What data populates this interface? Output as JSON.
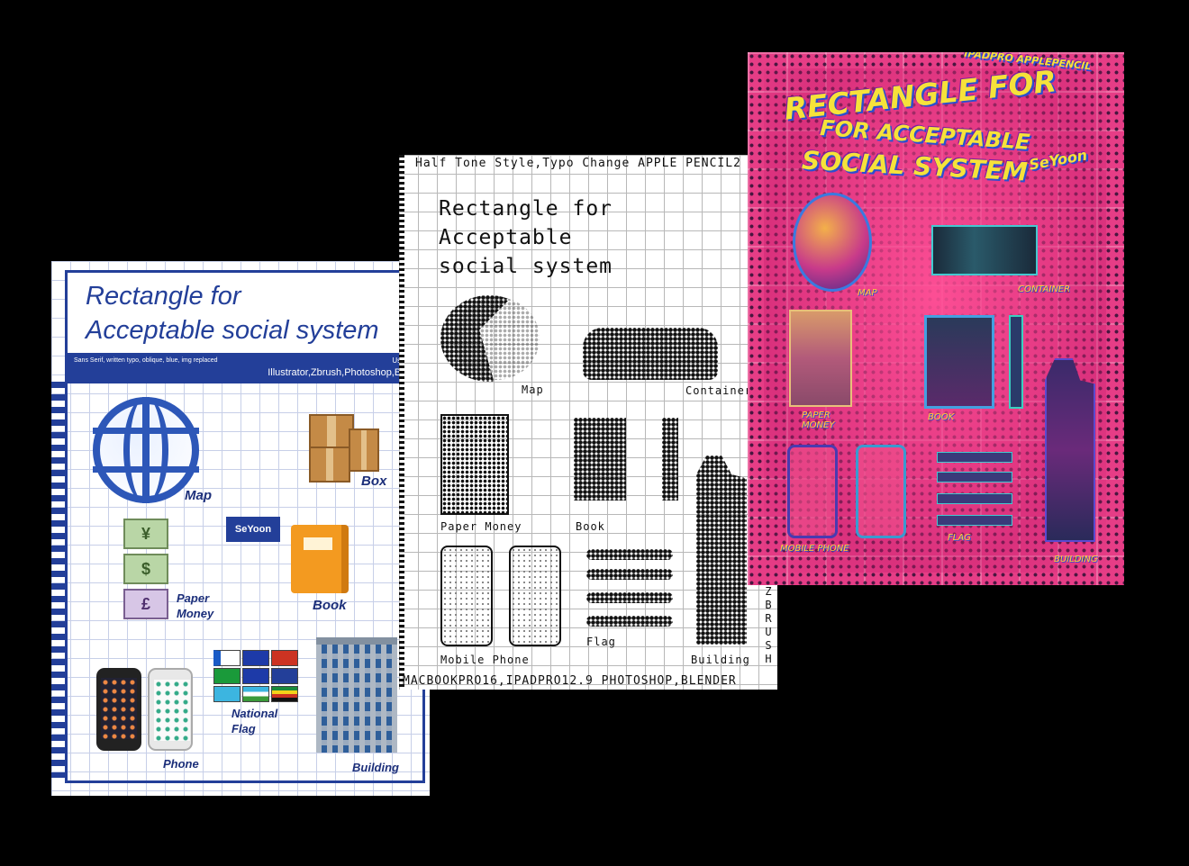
{
  "poster_blue": {
    "title": "Rectangle for\nAcceptable social system",
    "subtitle": "Sans Serif, written typo, oblique, blue, img replaced",
    "using_label": "Using Er",
    "tools": "Illustrator,Zbrush,Photoshop,Blend",
    "badge": "SeYoon",
    "labels": {
      "map": "Map",
      "box": "Box",
      "paper_money": "Paper\nMoney",
      "book": "Book",
      "national_flag": "National\nFlag",
      "phone": "Phone",
      "building": "Building"
    },
    "bill_symbols": [
      "¥",
      "$",
      "£"
    ]
  },
  "poster_halftone": {
    "header": "Half Tone Style,Typo Change APPLE PENCIL2",
    "title": "Rectangle for\nAcceptable\nsocial system",
    "labels": {
      "map": "Map",
      "container": "Container",
      "paper_money": "Paper Money",
      "book": "Book",
      "mobile_phone": "Mobile Phone",
      "flag": "Flag",
      "building": "Building"
    },
    "footer": "MACBOOKPRO16,IPADPRO12.9 PHOTOSHOP,BLENDER",
    "vertical": "ZBRUSH"
  },
  "poster_pink": {
    "title_line1": "RECTANGLE FOR",
    "title_line2": "FOR ACCEPTABLE",
    "title_line3": "SOCIAL SYSTEM",
    "signature": "SeYoon",
    "header_tag": "IPADPRO APPLEPENCIL",
    "labels": {
      "map": "MAP",
      "container": "CONTAINER",
      "paper_money": "PAPER\nMONEY",
      "book": "BOOK",
      "mobile_phone": "MOBILE PHONE",
      "flag": "FLAG",
      "building": "BUILDING"
    }
  },
  "colors": {
    "background": "#000000",
    "blue_accent": "#233f99",
    "pink_bg": "#e63d86",
    "pink_text": "#f6e23a"
  }
}
